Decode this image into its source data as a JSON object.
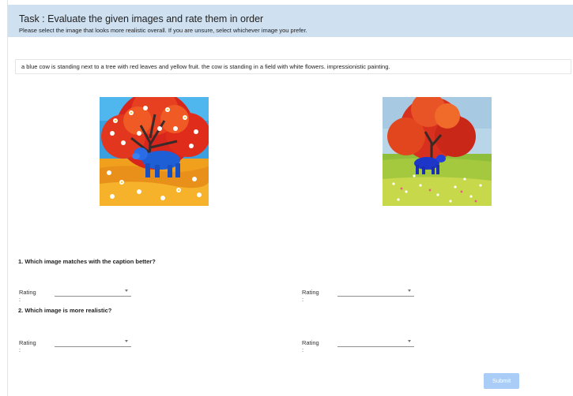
{
  "header": {
    "title": "Task : Evaluate the given images and rate them in order",
    "subtitle": "Please select the image that looks more realistic overall. If you are unsure, select whichever image you prefer."
  },
  "caption": "a blue cow is standing next to a tree with red leaves and yellow fruit. the cow is standing in a field with white flowers. impressionistic painting.",
  "images": [
    {
      "name": "painting-left",
      "description": "impressionist blue cow under red tree in orange flower field"
    },
    {
      "name": "painting-right",
      "description": "blue cow under red tree in green meadow"
    }
  ],
  "questions": [
    {
      "label": "1. Which image matches with the caption better?",
      "ratings": [
        {
          "label": "Rating :",
          "value": ""
        },
        {
          "label": "Rating :",
          "value": ""
        }
      ]
    },
    {
      "label": "2. Which image is more realistic?",
      "ratings": [
        {
          "label": "Rating :",
          "value": ""
        },
        {
          "label": "Rating :",
          "value": ""
        }
      ]
    }
  ],
  "submit_label": "Submit",
  "colors": {
    "header_bg": "#cfe0f1",
    "submit_bg": "#a9cdf6"
  }
}
